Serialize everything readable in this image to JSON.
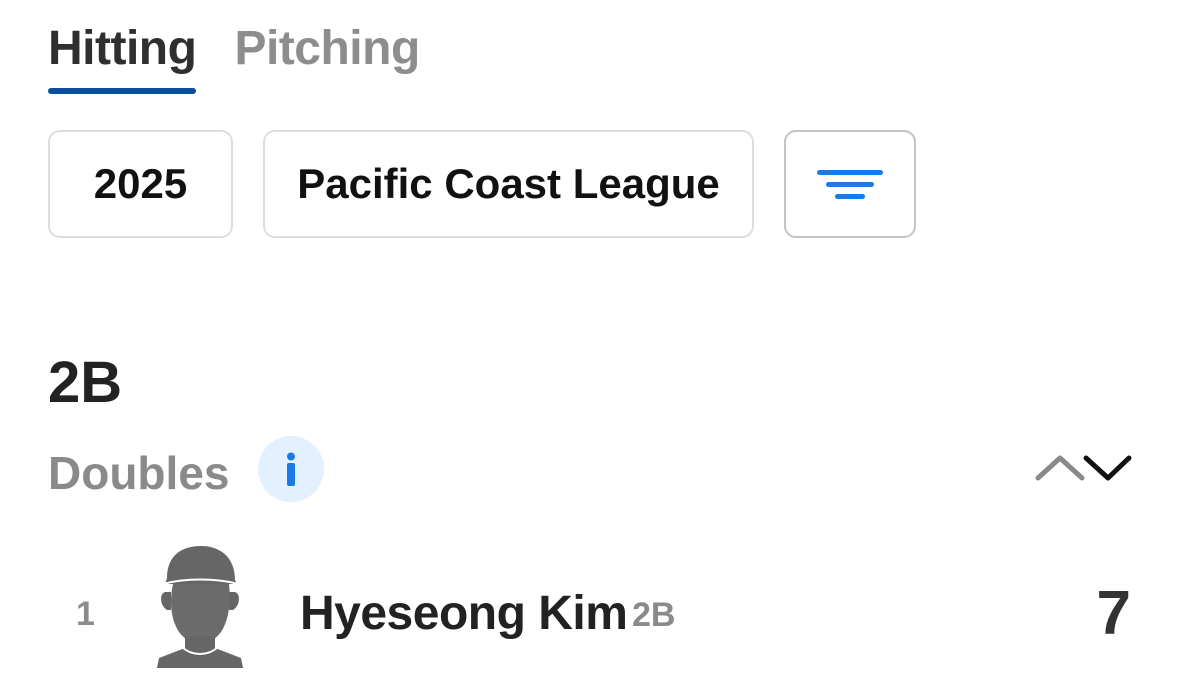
{
  "tabs": [
    {
      "label": "Hitting",
      "active": true
    },
    {
      "label": "Pitching",
      "active": false
    }
  ],
  "filters": {
    "season": "2025",
    "league": "Pacific Coast League",
    "filter_icon": "filter-lines-icon"
  },
  "stat": {
    "abbreviation": "2B",
    "name": "Doubles",
    "info_icon": "info-icon",
    "sort_icons": [
      "chevron-up-icon",
      "chevron-down-icon"
    ]
  },
  "leaders": [
    {
      "rank": "1",
      "name": "Hyeseong Kim",
      "position": "2B",
      "value": "7",
      "headshot_icon": "player-silhouette-icon"
    }
  ],
  "colors": {
    "accent_blue": "#1a7ae8",
    "tab_underline": "#0b4c9c",
    "info_bg": "#e3f0fd",
    "muted_text": "#8a8a8a"
  }
}
